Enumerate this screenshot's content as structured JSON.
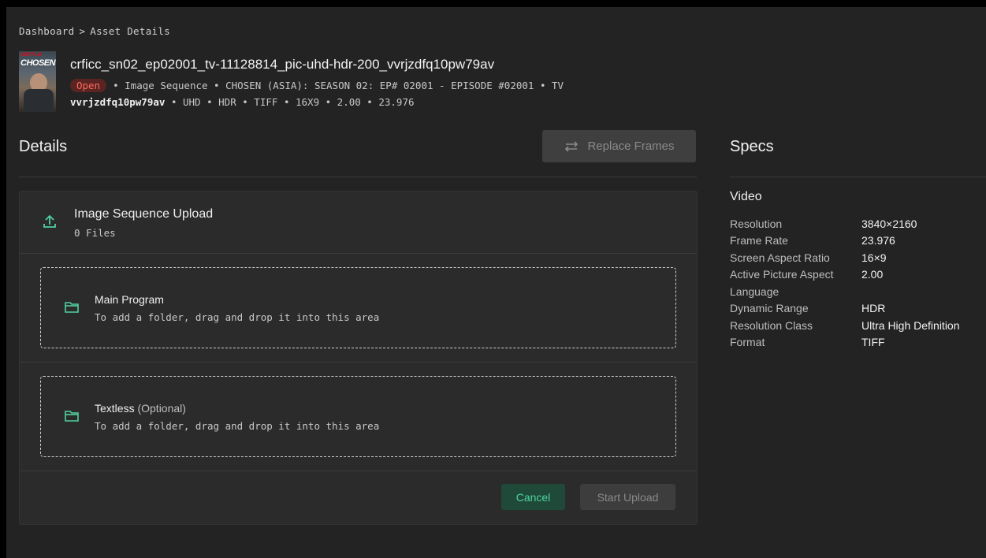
{
  "breadcrumb": [
    "Dashboard",
    ">",
    "Asset Details"
  ],
  "poster": {
    "brand": "NETFLIX",
    "title": "CHOSEN"
  },
  "asset": {
    "title": "crficc_sn02_ep02001_tv-11128814_pic-uhd-hdr-200_vvrjzdfq10pw79av",
    "status": "Open",
    "meta_line1": "• Image Sequence • CHOSEN (ASIA): SEASON 02: EP# 02001 - EPISODE #02001 • TV",
    "meta_id": "vvrjzdfq10pw79av",
    "meta_line2": "• UHD • HDR • TIFF • 16X9 • 2.00 • 23.976"
  },
  "details": {
    "title": "Details",
    "replace_button": "Replace Frames"
  },
  "upload": {
    "title": "Image Sequence Upload",
    "count": "0 Files",
    "zones": [
      {
        "title": "Main Program",
        "optional": "",
        "hint": "To add a folder, drag and drop it into this area"
      },
      {
        "title": "Textless",
        "optional": "(Optional)",
        "hint": "To add a folder, drag and drop it into this area"
      }
    ],
    "cancel": "Cancel",
    "start": "Start Upload"
  },
  "specs": {
    "title": "Specs",
    "section": "Video",
    "rows": [
      {
        "label": "Resolution",
        "value": "3840×2160"
      },
      {
        "label": "Frame Rate",
        "value": "23.976"
      },
      {
        "label": "Screen Aspect Ratio",
        "value": "16×9"
      },
      {
        "label": "Active Picture Aspect",
        "value": "2.00"
      },
      {
        "label": "Language",
        "value": ""
      },
      {
        "label": "Dynamic Range",
        "value": "HDR"
      },
      {
        "label": "Resolution Class",
        "value": "Ultra High Definition"
      },
      {
        "label": "Format",
        "value": "TIFF"
      }
    ]
  },
  "colors": {
    "accent": "#4fd1a0",
    "status_open": "#ff6b5c",
    "background": "#232323"
  }
}
